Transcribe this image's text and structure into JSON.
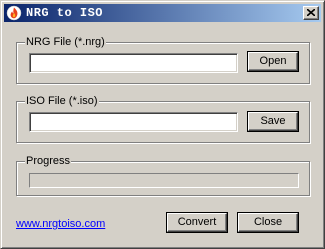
{
  "window": {
    "title": "NRG to ISO",
    "icon": "flame-icon",
    "close_icon": "close-icon"
  },
  "nrg_group": {
    "label": "NRG File (*.nrg)",
    "input_value": "",
    "open_label": "Open"
  },
  "iso_group": {
    "label": "ISO File (*.iso)",
    "input_value": "",
    "save_label": "Save"
  },
  "progress_group": {
    "label": "Progress",
    "value_percent": 0
  },
  "footer": {
    "link_text": "www.nrgtoiso.com",
    "convert_label": "Convert",
    "close_label": "Close"
  },
  "colors": {
    "titlebar_start": "#0a246a",
    "titlebar_end": "#a6caf0",
    "face": "#d4d0c8",
    "link": "#0000ff"
  }
}
